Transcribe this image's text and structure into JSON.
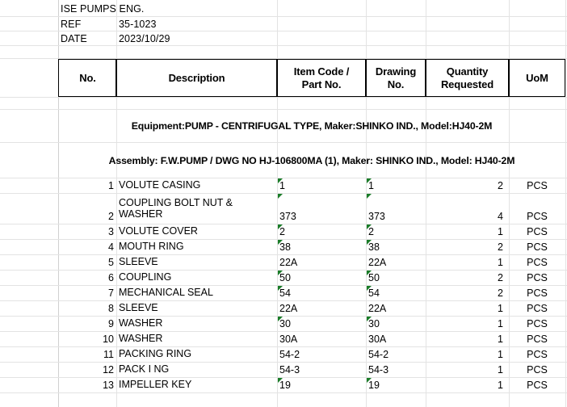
{
  "document": {
    "company": "ISE PUMPS ENG.",
    "ref_label": "REF",
    "ref_value": "35-1023",
    "date_label": "DATE",
    "date_value": "2023/10/29"
  },
  "table": {
    "headers": {
      "no": "No.",
      "description": "Description",
      "item_code_line1": "Item Code /",
      "item_code_line2": "Part No.",
      "drawing_line1": "Drawing",
      "drawing_line2": "No.",
      "quantity_line1": "Quantity",
      "quantity_line2": "Requested",
      "uom": "UoM"
    },
    "equipment_row": "Equipment:PUMP - CENTRIFUGAL TYPE, Maker:SHINKO IND., Model:HJ40-2M",
    "assembly_row": "Assembly: F.W.PUMP / DWG NO HJ-106800MA (1), Maker: SHINKO IND., Model: HJ40-2M",
    "rows": [
      {
        "no": "1",
        "description": "VOLUTE CASING",
        "item_code": "1",
        "drawing_no": "1",
        "quantity": "2",
        "uom": "PCS",
        "flag_item": true,
        "flag_drawing": true,
        "tall": false
      },
      {
        "no": "2",
        "description": "COUPLING BOLT NUT & WASHER",
        "item_code": "373",
        "drawing_no": "373",
        "quantity": "4",
        "uom": "PCS",
        "flag_item": true,
        "flag_drawing": true,
        "tall": true
      },
      {
        "no": "3",
        "description": "VOLUTE COVER",
        "item_code": "2",
        "drawing_no": "2",
        "quantity": "1",
        "uom": "PCS",
        "flag_item": true,
        "flag_drawing": true,
        "tall": false
      },
      {
        "no": "4",
        "description": "MOUTH RING",
        "item_code": "38",
        "drawing_no": "38",
        "quantity": "2",
        "uom": "PCS",
        "flag_item": true,
        "flag_drawing": true,
        "tall": false
      },
      {
        "no": "5",
        "description": "SLEEVE",
        "item_code": "22A",
        "drawing_no": "22A",
        "quantity": "1",
        "uom": "PCS",
        "flag_item": false,
        "flag_drawing": false,
        "tall": false
      },
      {
        "no": "6",
        "description": "COUPLING",
        "item_code": "50",
        "drawing_no": "50",
        "quantity": "2",
        "uom": "PCS",
        "flag_item": true,
        "flag_drawing": true,
        "tall": false
      },
      {
        "no": "7",
        "description": "MECHANICAL SEAL",
        "item_code": "54",
        "drawing_no": "54",
        "quantity": "2",
        "uom": "PCS",
        "flag_item": true,
        "flag_drawing": true,
        "tall": false
      },
      {
        "no": "8",
        "description": "SLEEVE",
        "item_code": "22A",
        "drawing_no": "22A",
        "quantity": "1",
        "uom": "PCS",
        "flag_item": false,
        "flag_drawing": false,
        "tall": false
      },
      {
        "no": "9",
        "description": "WASHER",
        "item_code": "30",
        "drawing_no": "30",
        "quantity": "1",
        "uom": "PCS",
        "flag_item": true,
        "flag_drawing": true,
        "tall": false
      },
      {
        "no": "10",
        "description": "WASHER",
        "item_code": "30A",
        "drawing_no": "30A",
        "quantity": "1",
        "uom": "PCS",
        "flag_item": false,
        "flag_drawing": false,
        "tall": false
      },
      {
        "no": "11",
        "description": "PACKING RING",
        "item_code": "54-2",
        "drawing_no": "54-2",
        "quantity": "1",
        "uom": "PCS",
        "flag_item": false,
        "flag_drawing": false,
        "tall": false
      },
      {
        "no": "12",
        "description": "PACK I NG",
        "item_code": "54-3",
        "drawing_no": "54-3",
        "quantity": "1",
        "uom": "PCS",
        "flag_item": false,
        "flag_drawing": false,
        "tall": false
      },
      {
        "no": "13",
        "description": "IMPELLER KEY",
        "item_code": "19",
        "drawing_no": "19",
        "quantity": "1",
        "uom": "PCS",
        "flag_item": true,
        "flag_drawing": true,
        "tall": false
      }
    ]
  },
  "colors": {
    "gridline": "#e3e3e3",
    "border": "#000000",
    "error_flag": "#1a7c28",
    "text": "#000000"
  },
  "layout": {
    "columns_x": [
      0,
      72,
      144,
      343,
      453,
      527,
      630,
      700
    ],
    "rows_top_y": [
      0,
      21,
      38,
      56,
      72,
      120,
      135,
      176,
      220
    ]
  }
}
